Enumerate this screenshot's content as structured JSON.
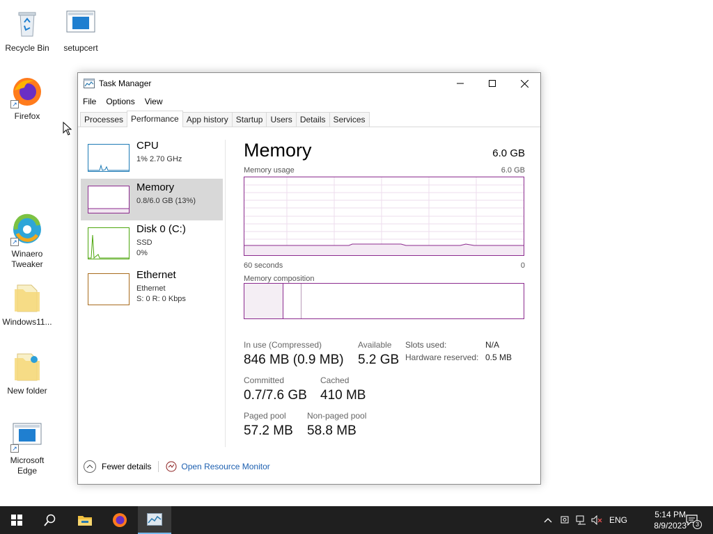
{
  "desktop": {
    "icons": {
      "recycle": "Recycle Bin",
      "setupcert": "setupcert",
      "firefox": "Firefox",
      "winaero": "Winaero\nTweaker",
      "windows11": "Windows11...",
      "new_folder": "New folder",
      "edge": "Microsoft\nEdge"
    }
  },
  "window": {
    "title": "Task Manager",
    "menu": [
      "File",
      "Options",
      "View"
    ],
    "tabs": [
      "Processes",
      "Performance",
      "App history",
      "Startup",
      "Users",
      "Details",
      "Services"
    ],
    "active_tab": "Performance"
  },
  "resources": [
    {
      "name": "CPU",
      "line1": "1% 2.70 GHz",
      "line2": "",
      "color": "#1c7ab5"
    },
    {
      "name": "Memory",
      "line1": "0.8/6.0 GB (13%)",
      "line2": "",
      "color": "#8b2a8e"
    },
    {
      "name": "Disk 0 (C:)",
      "line1": "SSD",
      "line2": "0%",
      "color": "#4da60c"
    },
    {
      "name": "Ethernet",
      "line1": "Ethernet",
      "line2": "S: 0 R: 0 Kbps",
      "color": "#a86b1c"
    }
  ],
  "memory": {
    "title": "Memory",
    "total": "6.0 GB",
    "usage_label": "Memory usage",
    "usage_max": "6.0 GB",
    "time_left": "60 seconds",
    "time_right": "0",
    "composition_label": "Memory composition",
    "stats": {
      "in_use_label": "In use (Compressed)",
      "in_use_value": "846 MB (0.9 MB)",
      "available_label": "Available",
      "available_value": "5.2 GB",
      "committed_label": "Committed",
      "committed_value": "0.7/7.6 GB",
      "cached_label": "Cached",
      "cached_value": "410 MB",
      "paged_label": "Paged pool",
      "paged_value": "57.2 MB",
      "nonpaged_label": "Non-paged pool",
      "nonpaged_value": "58.8 MB",
      "slots_label": "Slots used:",
      "slots_value": "N/A",
      "hw_label": "Hardware reserved:",
      "hw_value": "0.5 MB"
    }
  },
  "footer": {
    "fewer_details": "Fewer details",
    "resource_monitor": "Open Resource Monitor"
  },
  "taskbar": {
    "lang": "ENG",
    "time": "5:14 PM",
    "date": "8/9/2023",
    "notifications": "3"
  }
}
